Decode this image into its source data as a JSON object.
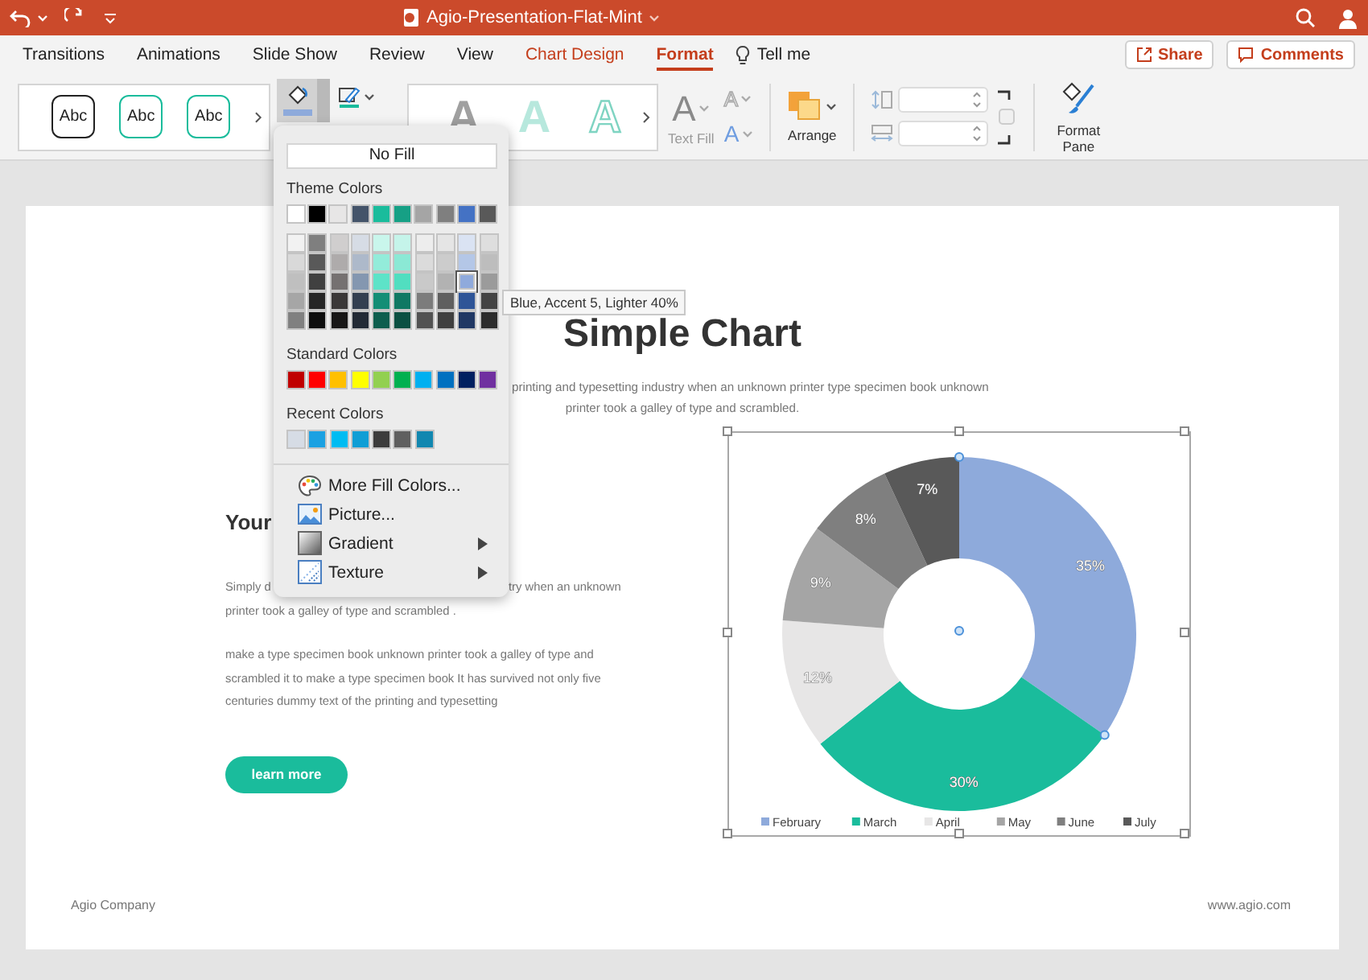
{
  "window": {
    "title": "Agio-Presentation-Flat-Mint"
  },
  "tabs": [
    {
      "label": "Transitions",
      "selected": false,
      "kind": "plain"
    },
    {
      "label": "Animations",
      "selected": false,
      "kind": "plain"
    },
    {
      "label": "Slide Show",
      "selected": false,
      "kind": "plain"
    },
    {
      "label": "Review",
      "selected": false,
      "kind": "plain"
    },
    {
      "label": "View",
      "selected": false,
      "kind": "plain"
    },
    {
      "label": "Chart Design",
      "selected": false,
      "kind": "contextual"
    },
    {
      "label": "Format",
      "selected": true,
      "kind": "contextual"
    }
  ],
  "tell_me": "Tell me",
  "share": "Share",
  "comments": "Comments",
  "ribbon": {
    "shape_styles": [
      {
        "label": "Abc",
        "color": "#222222"
      },
      {
        "label": "Abc",
        "color": "#1abc9c"
      },
      {
        "label": "Abc",
        "color": "#1abc9c"
      }
    ],
    "shape_fill": {
      "color": "#8eaadb",
      "pressed": true
    },
    "shape_outline": {
      "color": "#1abc9c"
    },
    "wordart_styles": [
      {
        "label": "A",
        "kind": "fill"
      },
      {
        "label": "A",
        "kind": "gradient"
      },
      {
        "label": "A",
        "kind": "outline"
      }
    ],
    "text_fill": {
      "glyph": "A",
      "label": "Text Fill"
    },
    "text_outline": {
      "glyph": "A"
    },
    "text_effects": {
      "glyph": "A"
    },
    "arrange": {
      "label": "Arrange"
    },
    "format_pane": {
      "label": "Format Pane"
    }
  },
  "fill_menu": {
    "no_fill": "No Fill",
    "theme_title": "Theme Colors",
    "theme_colors": [
      {
        "color": "#ffffff"
      },
      {
        "color": "#000000"
      },
      {
        "color": "#e7e6e6"
      },
      {
        "color": "#44546a"
      },
      {
        "color": "#1abc9c"
      },
      {
        "color": "#16a085"
      },
      {
        "color": "#a5a5a5"
      },
      {
        "color": "#7f7f7f"
      },
      {
        "color": "#4472c4"
      },
      {
        "color": "#595959"
      }
    ],
    "shade_columns": [
      {
        "shades": [
          {
            "color": "#f2f2f2",
            "selected": false
          },
          {
            "color": "#d9d9d9",
            "selected": false
          },
          {
            "color": "#bfbfbf",
            "selected": false
          },
          {
            "color": "#a6a6a6",
            "selected": false
          },
          {
            "color": "#808080",
            "selected": false
          }
        ]
      },
      {
        "shades": [
          {
            "color": "#7f7f7f",
            "selected": false
          },
          {
            "color": "#595959",
            "selected": false
          },
          {
            "color": "#404040",
            "selected": false
          },
          {
            "color": "#262626",
            "selected": false
          },
          {
            "color": "#0d0d0d",
            "selected": false
          }
        ]
      },
      {
        "shades": [
          {
            "color": "#d0cece",
            "selected": false
          },
          {
            "color": "#aeabab",
            "selected": false
          },
          {
            "color": "#757171",
            "selected": false
          },
          {
            "color": "#3a3838",
            "selected": false
          },
          {
            "color": "#171616",
            "selected": false
          }
        ]
      },
      {
        "shades": [
          {
            "color": "#d6dce5",
            "selected": false
          },
          {
            "color": "#adb9ca",
            "selected": false
          },
          {
            "color": "#8497b0",
            "selected": false
          },
          {
            "color": "#333f50",
            "selected": false
          },
          {
            "color": "#222a35",
            "selected": false
          }
        ]
      },
      {
        "shades": [
          {
            "color": "#c9f6ec",
            "selected": false
          },
          {
            "color": "#93ecda",
            "selected": false
          },
          {
            "color": "#5de3c8",
            "selected": false
          },
          {
            "color": "#148e76",
            "selected": false
          },
          {
            "color": "#0d5e4e",
            "selected": false
          }
        ]
      },
      {
        "shades": [
          {
            "color": "#c5f4ea",
            "selected": false
          },
          {
            "color": "#8be9d5",
            "selected": false
          },
          {
            "color": "#51dec0",
            "selected": false
          },
          {
            "color": "#107863",
            "selected": false
          },
          {
            "color": "#0b5042",
            "selected": false
          }
        ]
      },
      {
        "shades": [
          {
            "color": "#ededed",
            "selected": false
          },
          {
            "color": "#dbdbdb",
            "selected": false
          },
          {
            "color": "#c9c9c9",
            "selected": false
          },
          {
            "color": "#7c7c7c",
            "selected": false
          },
          {
            "color": "#525252",
            "selected": false
          }
        ]
      },
      {
        "shades": [
          {
            "color": "#e5e5e5",
            "selected": false
          },
          {
            "color": "#cccccc",
            "selected": false
          },
          {
            "color": "#b2b2b2",
            "selected": false
          },
          {
            "color": "#5f5f5f",
            "selected": false
          },
          {
            "color": "#3f3f3f",
            "selected": false
          }
        ]
      },
      {
        "shades": [
          {
            "color": "#dae3f3",
            "selected": false
          },
          {
            "color": "#b4c7e7",
            "selected": false
          },
          {
            "color": "#8faadc",
            "selected": true
          },
          {
            "color": "#2f5597",
            "selected": false
          },
          {
            "color": "#203864",
            "selected": false
          }
        ]
      },
      {
        "shades": [
          {
            "color": "#dedede",
            "selected": false
          },
          {
            "color": "#bdbdbd",
            "selected": false
          },
          {
            "color": "#9b9b9b",
            "selected": false
          },
          {
            "color": "#434343",
            "selected": false
          },
          {
            "color": "#2d2d2d",
            "selected": false
          }
        ]
      }
    ],
    "standard_title": "Standard Colors",
    "standard_colors": [
      {
        "color": "#c00000"
      },
      {
        "color": "#ff0000"
      },
      {
        "color": "#ffc000"
      },
      {
        "color": "#ffff00"
      },
      {
        "color": "#92d050"
      },
      {
        "color": "#00b050"
      },
      {
        "color": "#00b0f0"
      },
      {
        "color": "#0070c0"
      },
      {
        "color": "#002060"
      },
      {
        "color": "#7030a0"
      }
    ],
    "recent_title": "Recent Colors",
    "recent_colors": [
      {
        "color": "#d6dce5"
      },
      {
        "color": "#1ba1e2"
      },
      {
        "color": "#00bcf2"
      },
      {
        "color": "#0f9ed5"
      },
      {
        "color": "#3c3c3c"
      },
      {
        "color": "#5f5f5f"
      },
      {
        "color": "#1187b0"
      }
    ],
    "items": [
      {
        "label": "More Fill Colors...",
        "kind": "palette",
        "submenu": false
      },
      {
        "label": "Picture...",
        "kind": "picture",
        "submenu": false
      },
      {
        "label": "Gradient",
        "kind": "gradient",
        "submenu": true
      },
      {
        "label": "Texture",
        "kind": "texture",
        "submenu": true
      }
    ],
    "tooltip": "Blue, Accent 5, Lighter 40%"
  },
  "slide": {
    "title": "Simple Chart",
    "subtitle_lines": [
      "printing and typesetting industry when an unknown printer type specimen book unknown",
      "printer took a galley of type and scrambled."
    ],
    "heading": "Your",
    "line_start": "Simply d",
    "line_end": "try when an unknown",
    "line_2": "printer took a galley of type and scrambled .",
    "paragraph_lines": [
      "make a type specimen book unknown printer took a galley of type and",
      "scrambled it to make a type specimen book It has survived not only five",
      "centuries dummy text of the printing and typesetting"
    ],
    "button": "learn more",
    "chart_data": {
      "type": "donut",
      "categories": [
        "February",
        "March",
        "April",
        "May",
        "June",
        "July"
      ],
      "values": [
        35,
        30,
        12,
        9,
        8,
        7
      ],
      "colors": [
        "#8eaadb",
        "#1abc9c",
        "#e7e6e6",
        "#a5a5a5",
        "#7f7f7f",
        "#595959"
      ],
      "value_labels": [
        "35%",
        "30%",
        "12%",
        "9%",
        "8%",
        "7%"
      ],
      "legend": "bottom"
    },
    "footer_left": "Agio Company",
    "footer_right": "www.agio.com"
  }
}
